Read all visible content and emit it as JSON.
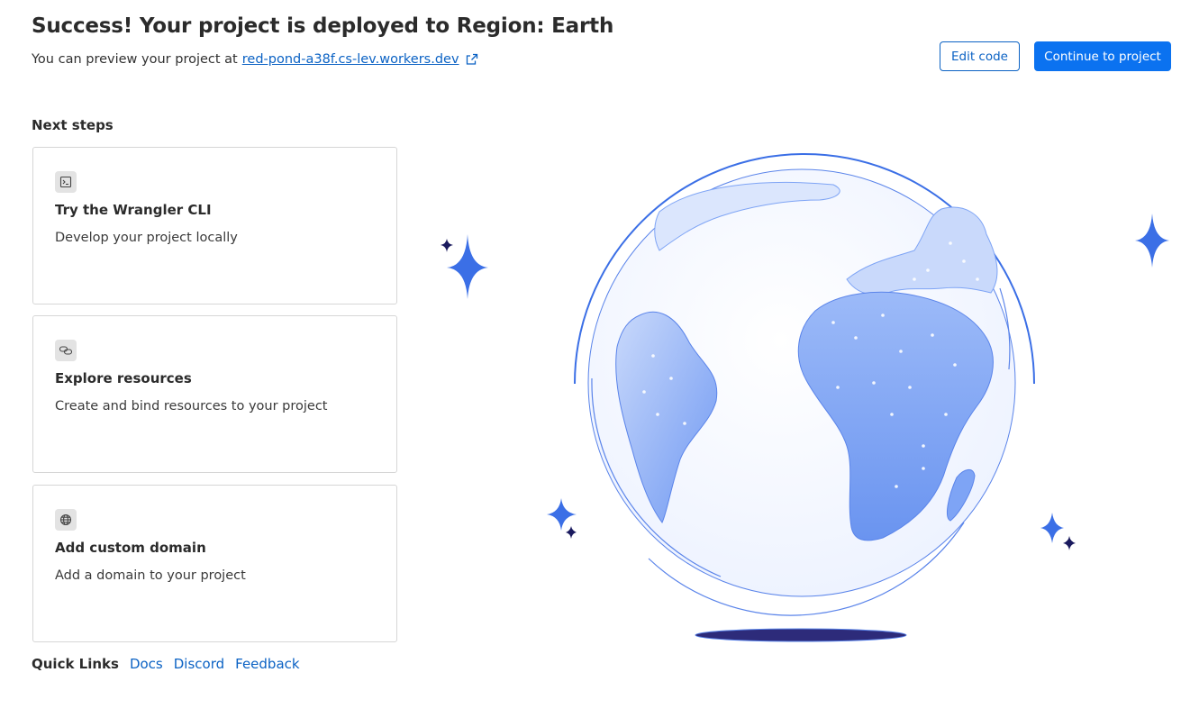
{
  "header": {
    "title": "Success! Your project is deployed to Region: Earth",
    "preview_prefix": "You can preview your project at",
    "preview_link": "red-pond-a38f.cs-lev.workers.dev",
    "link_icon": "external-link-icon"
  },
  "actions": {
    "edit_code": "Edit code",
    "continue": "Continue to project"
  },
  "next_steps": {
    "heading": "Next steps",
    "cards": [
      {
        "icon": "terminal-icon",
        "title": "Try the Wrangler CLI",
        "description": "Develop your project locally"
      },
      {
        "icon": "link-icon",
        "title": "Explore resources",
        "description": "Create and bind resources to your project"
      },
      {
        "icon": "globe-icon",
        "title": "Add custom domain",
        "description": "Add a domain to your project"
      }
    ]
  },
  "quick_links": {
    "label": "Quick Links",
    "links": [
      "Docs",
      "Discord",
      "Feedback"
    ]
  },
  "illustration": {
    "subject": "globe",
    "colors": {
      "accent": "#3b6fe6",
      "dark_star": "#1a1a5e",
      "ground_shadow": "#2d2b7a",
      "land": "#7ea4f5"
    }
  }
}
